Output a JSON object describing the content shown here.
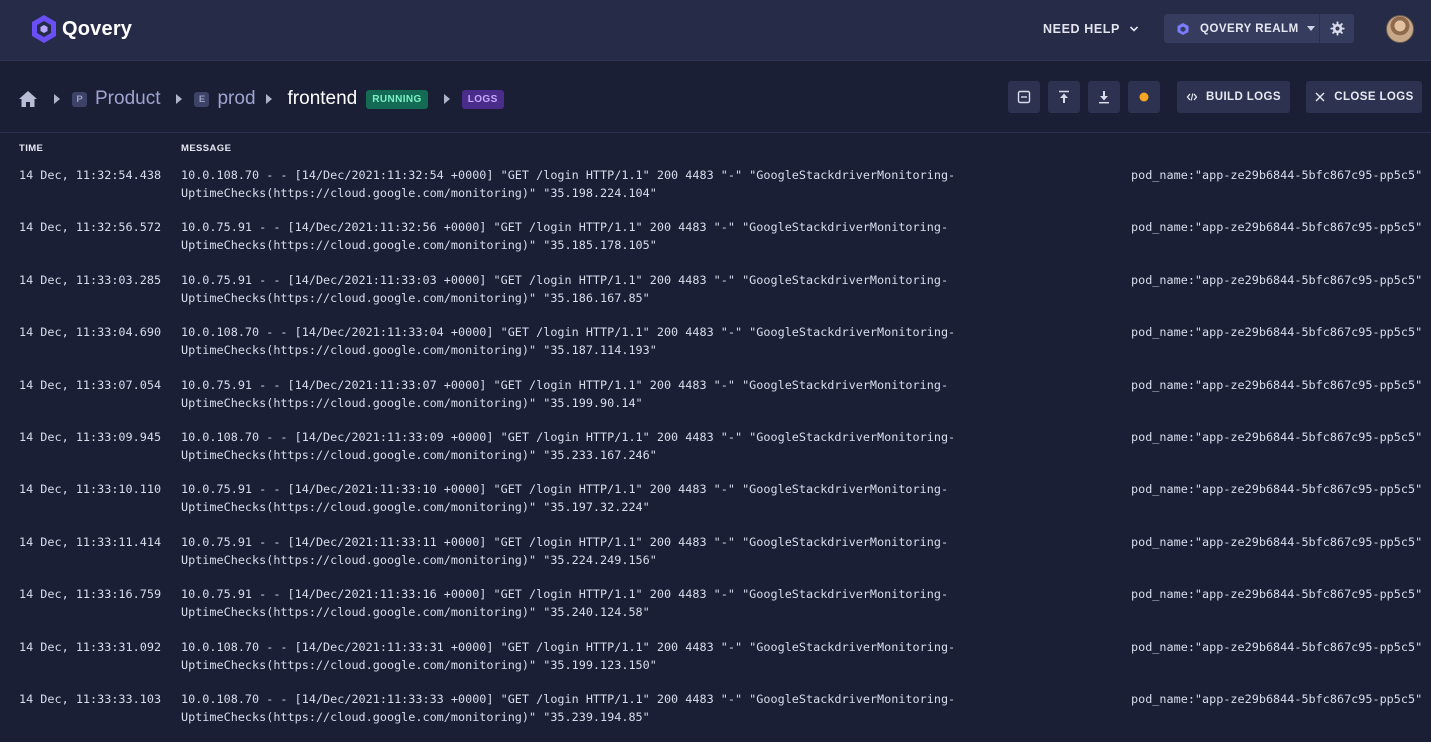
{
  "colors": {
    "background": "#1b1f36",
    "nav_background": "#262b48",
    "running_badge": "#126b52",
    "logs_badge": "#4a2d8a",
    "realm_icon": "#7c7cff"
  },
  "nav": {
    "brand": "Qovery",
    "help_label": "NEED HELP",
    "realm_label": "QOVERY REALM",
    "icons": [
      "qovery-logo-icon",
      "chevron-down-icon",
      "realm-icon",
      "caret-down-icon",
      "gear-icon",
      "avatar"
    ]
  },
  "breadcrumb": {
    "project_letter": "P",
    "project": "Product",
    "environment_letter": "E",
    "environment": "prod",
    "application": "frontend",
    "status": "RUNNING",
    "view": "LOGS"
  },
  "toolbar": {
    "collapse_icon": "collapse-icon",
    "scroll_top_icon": "scroll-top-icon",
    "download_icon": "download-icon",
    "live_indicator_color": "#f5a623",
    "build_logs_label": "BUILD LOGS",
    "close_logs_label": "CLOSE LOGS"
  },
  "table": {
    "headers": {
      "time": "TIME",
      "message": "MESSAGE"
    },
    "rows": [
      {
        "time": "14 Dec, 11:32:54.438",
        "message_line1": "10.0.108.70 - - [14/Dec/2021:11:32:54 +0000] \"GET /login HTTP/1.1\" 200 4483 \"-\" \"GoogleStackdriverMonitoring-",
        "message_line2": "UptimeChecks(https://cloud.google.com/monitoring)\" \"35.198.224.104\"",
        "pod": "pod_name:\"app-ze29b6844-5bfc867c95-pp5c5\""
      },
      {
        "time": "14 Dec, 11:32:56.572",
        "message_line1": "10.0.75.91 - - [14/Dec/2021:11:32:56 +0000] \"GET /login HTTP/1.1\" 200 4483 \"-\" \"GoogleStackdriverMonitoring-",
        "message_line2": "UptimeChecks(https://cloud.google.com/monitoring)\" \"35.185.178.105\"",
        "pod": "pod_name:\"app-ze29b6844-5bfc867c95-pp5c5\""
      },
      {
        "time": "14 Dec, 11:33:03.285",
        "message_line1": "10.0.75.91 - - [14/Dec/2021:11:33:03 +0000] \"GET /login HTTP/1.1\" 200 4483 \"-\" \"GoogleStackdriverMonitoring-",
        "message_line2": "UptimeChecks(https://cloud.google.com/monitoring)\" \"35.186.167.85\"",
        "pod": "pod_name:\"app-ze29b6844-5bfc867c95-pp5c5\""
      },
      {
        "time": "14 Dec, 11:33:04.690",
        "message_line1": "10.0.108.70 - - [14/Dec/2021:11:33:04 +0000] \"GET /login HTTP/1.1\" 200 4483 \"-\" \"GoogleStackdriverMonitoring-",
        "message_line2": "UptimeChecks(https://cloud.google.com/monitoring)\" \"35.187.114.193\"",
        "pod": "pod_name:\"app-ze29b6844-5bfc867c95-pp5c5\""
      },
      {
        "time": "14 Dec, 11:33:07.054",
        "message_line1": "10.0.75.91 - - [14/Dec/2021:11:33:07 +0000] \"GET /login HTTP/1.1\" 200 4483 \"-\" \"GoogleStackdriverMonitoring-",
        "message_line2": "UptimeChecks(https://cloud.google.com/monitoring)\" \"35.199.90.14\"",
        "pod": "pod_name:\"app-ze29b6844-5bfc867c95-pp5c5\""
      },
      {
        "time": "14 Dec, 11:33:09.945",
        "message_line1": "10.0.108.70 - - [14/Dec/2021:11:33:09 +0000] \"GET /login HTTP/1.1\" 200 4483 \"-\" \"GoogleStackdriverMonitoring-",
        "message_line2": "UptimeChecks(https://cloud.google.com/monitoring)\" \"35.233.167.246\"",
        "pod": "pod_name:\"app-ze29b6844-5bfc867c95-pp5c5\""
      },
      {
        "time": "14 Dec, 11:33:10.110",
        "message_line1": "10.0.75.91 - - [14/Dec/2021:11:33:10 +0000] \"GET /login HTTP/1.1\" 200 4483 \"-\" \"GoogleStackdriverMonitoring-",
        "message_line2": "UptimeChecks(https://cloud.google.com/monitoring)\" \"35.197.32.224\"",
        "pod": "pod_name:\"app-ze29b6844-5bfc867c95-pp5c5\""
      },
      {
        "time": "14 Dec, 11:33:11.414",
        "message_line1": "10.0.75.91 - - [14/Dec/2021:11:33:11 +0000] \"GET /login HTTP/1.1\" 200 4483 \"-\" \"GoogleStackdriverMonitoring-",
        "message_line2": "UptimeChecks(https://cloud.google.com/monitoring)\" \"35.224.249.156\"",
        "pod": "pod_name:\"app-ze29b6844-5bfc867c95-pp5c5\""
      },
      {
        "time": "14 Dec, 11:33:16.759",
        "message_line1": "10.0.75.91 - - [14/Dec/2021:11:33:16 +0000] \"GET /login HTTP/1.1\" 200 4483 \"-\" \"GoogleStackdriverMonitoring-",
        "message_line2": "UptimeChecks(https://cloud.google.com/monitoring)\" \"35.240.124.58\"",
        "pod": "pod_name:\"app-ze29b6844-5bfc867c95-pp5c5\""
      },
      {
        "time": "14 Dec, 11:33:31.092",
        "message_line1": "10.0.108.70 - - [14/Dec/2021:11:33:31 +0000] \"GET /login HTTP/1.1\" 200 4483 \"-\" \"GoogleStackdriverMonitoring-",
        "message_line2": "UptimeChecks(https://cloud.google.com/monitoring)\" \"35.199.123.150\"",
        "pod": "pod_name:\"app-ze29b6844-5bfc867c95-pp5c5\""
      },
      {
        "time": "14 Dec, 11:33:33.103",
        "message_line1": "10.0.108.70 - - [14/Dec/2021:11:33:33 +0000] \"GET /login HTTP/1.1\" 200 4483 \"-\" \"GoogleStackdriverMonitoring-",
        "message_line2": "UptimeChecks(https://cloud.google.com/monitoring)\" \"35.239.194.85\"",
        "pod": "pod_name:\"app-ze29b6844-5bfc867c95-pp5c5\""
      }
    ]
  }
}
